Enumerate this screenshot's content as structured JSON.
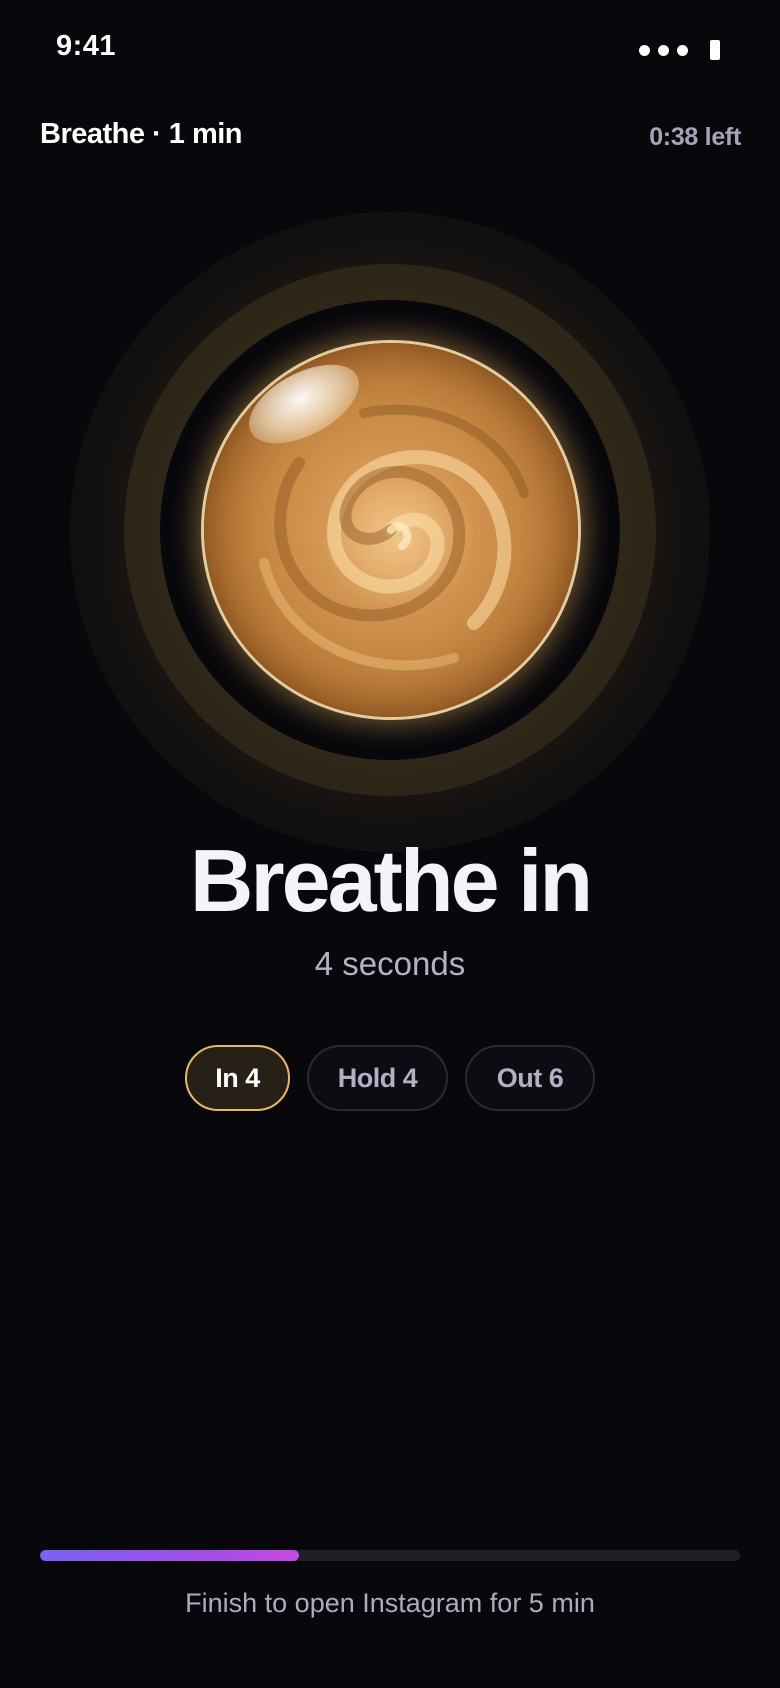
{
  "status_bar": {
    "time": "9:41"
  },
  "header": {
    "title": "Breathe · 1 min",
    "time_left": "0:38 left"
  },
  "phase": {
    "title": "Breathe in",
    "subtitle": "4 seconds"
  },
  "pills": [
    {
      "label": "In 4",
      "active": true
    },
    {
      "label": "Hold 4",
      "active": false
    },
    {
      "label": "Out 6",
      "active": false
    }
  ],
  "progress": {
    "fraction": 0.37
  },
  "footer": {
    "text": "Finish to open Instagram for 5 min"
  },
  "colors": {
    "background": "#07070c",
    "accent_gold": "#e6b96a",
    "progress_start": "#7a63f2",
    "progress_end": "#c54ae2"
  }
}
